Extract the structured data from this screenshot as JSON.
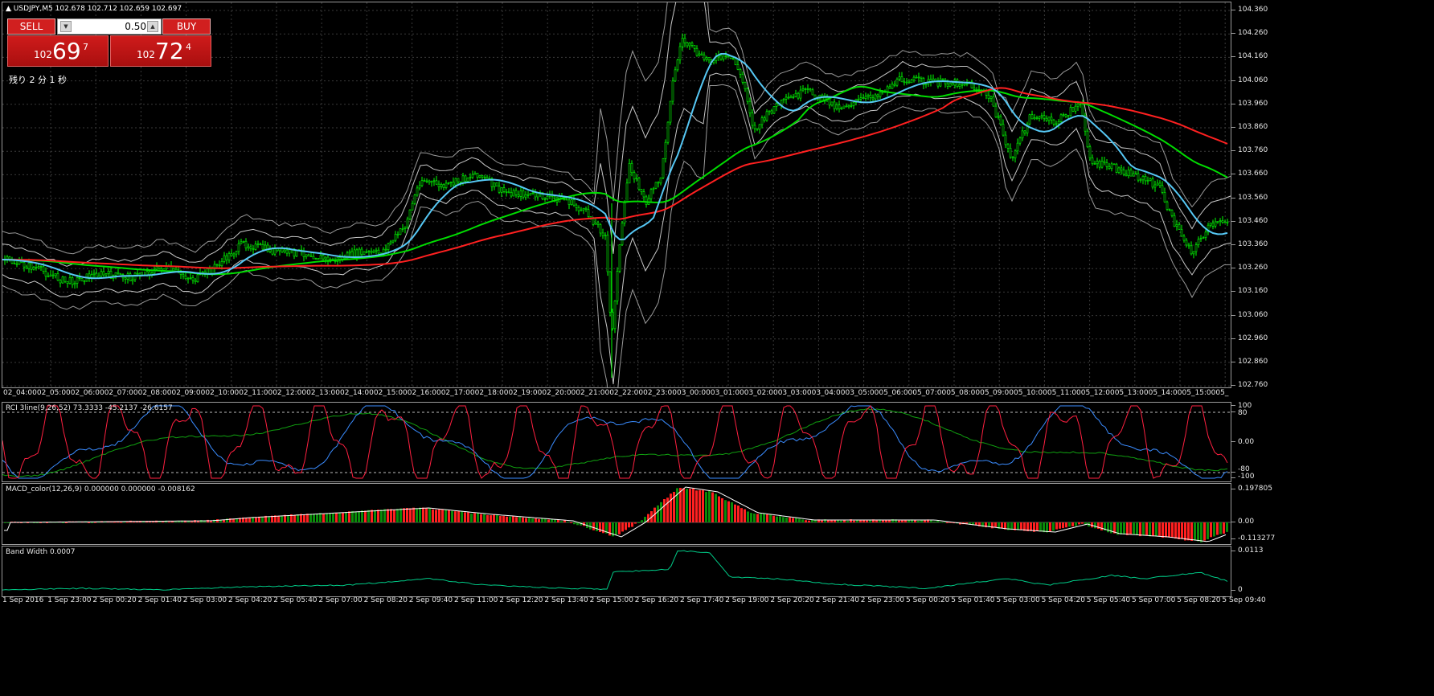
{
  "symbol_bar": {
    "text": "USDJPY,M5  102.678 102.712 102.659 102.697"
  },
  "one_click": {
    "sell_label": "SELL",
    "buy_label": "BUY",
    "lot": "0.50",
    "sell_price": {
      "prefix": "102",
      "big": "69",
      "sup": "7"
    },
    "buy_price": {
      "prefix": "102",
      "big": "72",
      "sup": "4"
    },
    "timer": "残り 2 分 1 秒"
  },
  "price_axis": [
    "104.360",
    "104.260",
    "104.160",
    "104.060",
    "103.960",
    "103.860",
    "103.760",
    "103.660",
    "103.560",
    "103.460",
    "103.360",
    "103.260",
    "103.160",
    "103.060",
    "102.960",
    "102.860",
    "102.760"
  ],
  "session_labels": [
    "02_04:00",
    "02_05:00",
    "02_06:00",
    "02_07:00",
    "02_08:00",
    "02_09:00",
    "02_10:00",
    "02_11:00",
    "02_12:00",
    "02_13:00",
    "02_14:00",
    "02_15:00",
    "02_16:00",
    "02_17:00",
    "02_18:00",
    "02_19:00",
    "02_20:00",
    "02_21:00",
    "02_22:00",
    "02_23:00",
    "03_00:00",
    "03_01:00",
    "03_02:00",
    "03_03:00",
    "03_04:00",
    "03_05:00",
    "05_06:00",
    "05_07:00",
    "05_08:00",
    "05_09:00",
    "05_10:00",
    "05_11:00",
    "05_12:00",
    "05_13:00",
    "05_14:00",
    "05_15:00",
    "05_"
  ],
  "rci": {
    "title": "RCI 3line(9,26,52) 73.3333 -45.2137 -26.6157",
    "axis": [
      "100",
      "80",
      "0.00",
      "-80",
      "-100"
    ]
  },
  "macd": {
    "title": "MACD_color(12,26,9) 0.000000 0.000000 -0.008162",
    "axis": [
      "0.197805",
      "0.00",
      "-0.113277"
    ]
  },
  "bandwidth": {
    "title": "Band Width 0.0007",
    "axis": [
      "0.0113",
      "0"
    ]
  },
  "time_axis": [
    "1 Sep 2016",
    "1 Sep 23:00",
    "2 Sep 00:20",
    "2 Sep 01:40",
    "2 Sep 03:00",
    "2 Sep 04:20",
    "2 Sep 05:40",
    "2 Sep 07:00",
    "2 Sep 08:20",
    "2 Sep 09:40",
    "2 Sep 11:00",
    "2 Sep 12:20",
    "2 Sep 13:40",
    "2 Sep 15:00",
    "2 Sep 16:20",
    "2 Sep 17:40",
    "2 Sep 19:00",
    "2 Sep 20:20",
    "2 Sep 21:40",
    "2 Sep 23:00",
    "5 Sep 00:20",
    "5 Sep 01:40",
    "5 Sep 03:00",
    "5 Sep 04:20",
    "5 Sep 05:40",
    "5 Sep 07:00",
    "5 Sep 08:20",
    "5 Sep 09:40"
  ],
  "colors": {
    "candles": "#00ff00",
    "ma_fast": "#56c8f5",
    "ma_mid": "#00dd00",
    "ma_slow": "#ff2020",
    "bands": "#c8c8c8",
    "macd_up": "#ff2020",
    "macd_down": "#0a8c0a",
    "bw_line": "#00cc88",
    "rci_short": "#ff2040",
    "rci_mid": "#3a8cff",
    "rci_long": "#10a010"
  }
}
